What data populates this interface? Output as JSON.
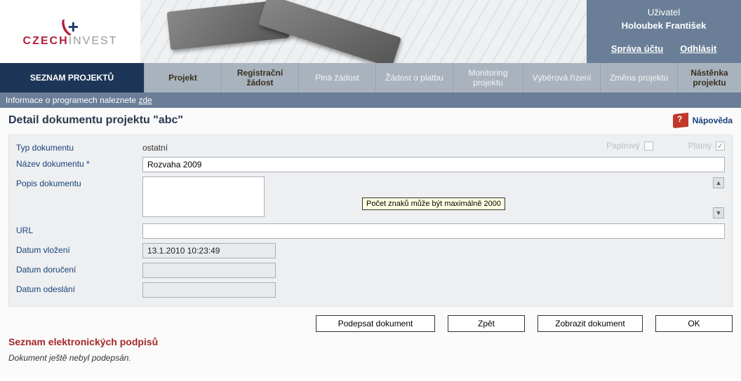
{
  "header": {
    "logo_czech": "CZECH",
    "logo_invest": "INVEST",
    "user_label": "Uživatel",
    "user_name": "Holoubek František",
    "account_link": "Správa účtu",
    "logout_link": "Odhlásit"
  },
  "nav": {
    "items": [
      {
        "label": "SEZNAM PROJEKTŮ",
        "style": "active"
      },
      {
        "label": "Projekt",
        "style": "dark"
      },
      {
        "label": "Registrační žádost",
        "style": "dark"
      },
      {
        "label": "Plná žádost",
        "style": "light"
      },
      {
        "label": "Žádost o platbu",
        "style": "light"
      },
      {
        "label": "Monitoring projektu",
        "style": "light"
      },
      {
        "label": "Výběrová řízení",
        "style": "light"
      },
      {
        "label": "Změna projektu",
        "style": "light"
      },
      {
        "label": "Nástěnka projektu",
        "style": "dark"
      }
    ]
  },
  "infobar": {
    "prefix": "Informace o programech naleznete ",
    "link": "zde"
  },
  "page": {
    "title": "Detail dokumentu projektu  \"abc\"",
    "help": "Nápověda"
  },
  "form": {
    "type_label": "Typ dokumentu",
    "type_value": "ostatní",
    "paper_label": "Papírový",
    "paper_checked": false,
    "valid_label": "Platný",
    "valid_checked": true,
    "name_label": "Název dokumentu *",
    "name_value": "Rozvaha 2009",
    "desc_label": "Popis dokumentu",
    "desc_value": "",
    "desc_tooltip": "Počet znaků může být maximálně 2000",
    "url_label": "URL",
    "url_value": "",
    "inserted_label": "Datum vložení",
    "inserted_value": "13.1.2010 10:23:49",
    "delivered_label": "Datum doručení",
    "delivered_value": "",
    "sent_label": "Datum odeslání",
    "sent_value": ""
  },
  "buttons": {
    "sign": "Podepsat dokument",
    "back": "Zpět",
    "show": "Zobrazit dokument",
    "ok": "OK"
  },
  "signatures": {
    "title": "Seznam elektronických podpisů",
    "msg": "Dokument ještě nebyl podepsán."
  }
}
